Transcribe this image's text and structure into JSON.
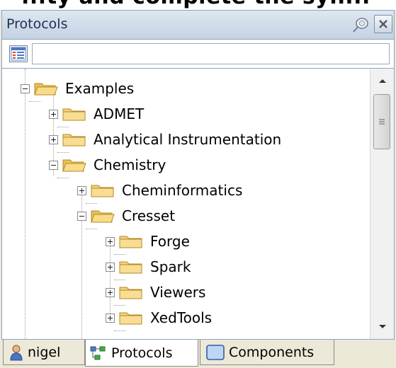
{
  "top_strip": {
    "text": "...ty and complete the syn..."
  },
  "panel": {
    "title": "Protocols"
  },
  "toolbar": {
    "search_value": "",
    "search_placeholder": ""
  },
  "tree": {
    "nodes": [
      {
        "label": "Examples",
        "icon": "folder-open-icon",
        "expander": "minus"
      },
      {
        "label": "ADMET",
        "icon": "folder-icon",
        "expander": "plus"
      },
      {
        "label": "Analytical Instrumentation",
        "icon": "folder-icon",
        "expander": "plus"
      },
      {
        "label": "Chemistry",
        "icon": "folder-open-icon",
        "expander": "minus"
      },
      {
        "label": "Cheminformatics",
        "icon": "folder-icon",
        "expander": "plus"
      },
      {
        "label": "Cresset",
        "icon": "folder-open-icon",
        "expander": "minus"
      },
      {
        "label": "Forge",
        "icon": "folder-icon",
        "expander": "plus"
      },
      {
        "label": "Spark",
        "icon": "folder-icon",
        "expander": "plus"
      },
      {
        "label": "Viewers",
        "icon": "folder-icon",
        "expander": "plus"
      },
      {
        "label": "XedTools",
        "icon": "folder-icon",
        "expander": "plus"
      }
    ]
  },
  "tabs": [
    {
      "label": "nigel",
      "icon": "user-icon"
    },
    {
      "label": "Protocols",
      "icon": "protocols-icon",
      "active": true
    },
    {
      "label": "Components",
      "icon": "components-icon"
    }
  ],
  "colors": {
    "panel_bg": "#ece9d8",
    "titlebar": "#c4d2e3",
    "folder": "#f3d27a"
  }
}
